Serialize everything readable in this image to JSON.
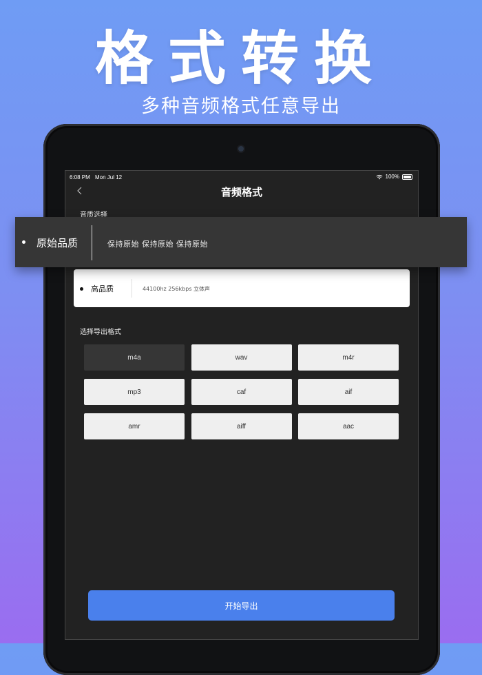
{
  "hero": {
    "title": "格式转换",
    "subtitle": "多种音频格式任意导出"
  },
  "status_bar": {
    "time": "6:08 PM",
    "date": "Mon Jul 12",
    "battery": "100%"
  },
  "nav": {
    "back_icon": "chevron-left-icon",
    "title": "音频格式"
  },
  "quality": {
    "section_label": "音质选择",
    "options": [
      {
        "name": "原始品质",
        "description": "保持原始  保持原始  保持原始",
        "selected": true
      },
      {
        "name": "高品质",
        "description": "44100hz  256kbps  立体声",
        "selected": false
      }
    ]
  },
  "formats": {
    "section_label": "选择导出格式",
    "items": [
      "m4a",
      "wav",
      "m4r",
      "mp3",
      "caf",
      "aif",
      "amr",
      "aiff",
      "aac"
    ],
    "selected": "m4a"
  },
  "export_button": "开始导出",
  "colors": {
    "accent": "#4a80ec",
    "background_top": "#6f9cf4",
    "background_bottom": "#9a6df0",
    "screen": "#222222"
  }
}
